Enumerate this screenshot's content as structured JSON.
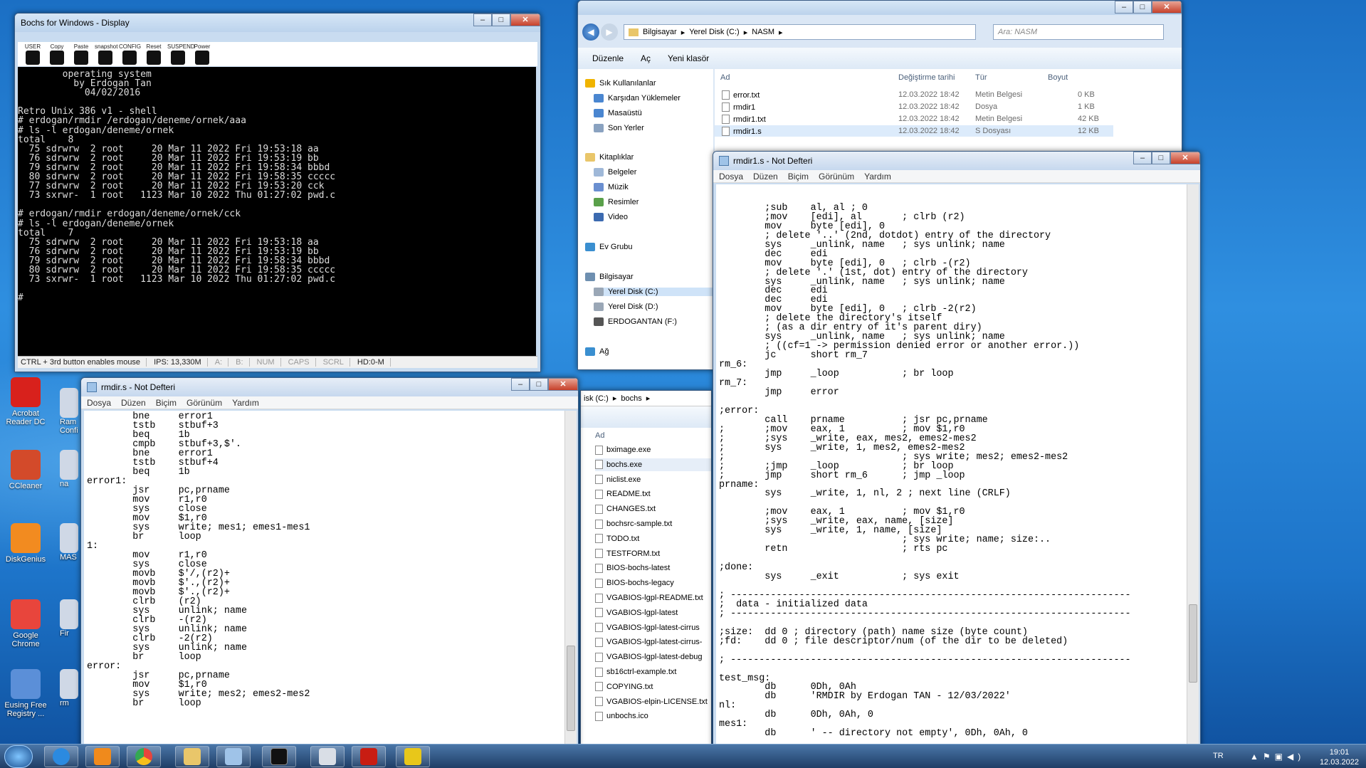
{
  "desktop": {
    "icons": [
      {
        "label": "Acrobat Reader DC",
        "color": "#d8211c"
      },
      {
        "label": "CCleaner",
        "color": "#d34a2a"
      },
      {
        "label": "DiskGenius",
        "color": "#f28b20"
      },
      {
        "label": "Google Chrome",
        "color": "#e8453c"
      },
      {
        "label": "Eusing Free Registry ...",
        "color": "#5b8fd8"
      }
    ],
    "partial_icons": [
      "Ram Confi",
      "na",
      "MAS",
      "Fir",
      "rm"
    ]
  },
  "bochs": {
    "title": "Bochs for Windows - Display",
    "toolbar": [
      "USER",
      "Copy",
      "Paste",
      "snapshot",
      "CONFIG",
      "Reset",
      "SUSPEND",
      "Power"
    ],
    "terminal": [
      "        operating system",
      "          by Erdogan Tan",
      "            04/02/2016",
      "",
      "Retro Unix 386 v1 - shell",
      "# erdogan/rmdir /erdogan/deneme/ornek/aaa",
      "# ls -l erdogan/deneme/ornek",
      "total    8",
      "  75 sdrwrw  2 root     20 Mar 11 2022 Fri 19:53:18 aa",
      "  76 sdrwrw  2 root     20 Mar 11 2022 Fri 19:53:19 bb",
      "  79 sdrwrw  2 root     20 Mar 11 2022 Fri 19:58:34 bbbd",
      "  80 sdrwrw  2 root     20 Mar 11 2022 Fri 19:58:35 ccccc",
      "  77 sdrwrw  2 root     20 Mar 11 2022 Fri 19:53:20 cck",
      "  73 sxrwr-  1 root   1123 Mar 10 2022 Thu 01:27:02 pwd.c",
      "",
      "# erdogan/rmdir erdogan/deneme/ornek/cck",
      "# ls -l erdogan/deneme/ornek",
      "total    7",
      "  75 sdrwrw  2 root     20 Mar 11 2022 Fri 19:53:18 aa",
      "  76 sdrwrw  2 root     20 Mar 11 2022 Fri 19:53:19 bb",
      "  79 sdrwrw  2 root     20 Mar 11 2022 Fri 19:58:34 bbbd",
      "  80 sdrwrw  2 root     20 Mar 11 2022 Fri 19:58:35 ccccc",
      "  73 sxrwr-  1 root   1123 Mar 10 2022 Thu 01:27:02 pwd.c",
      "",
      "#"
    ],
    "status": [
      "CTRL + 3rd button enables mouse",
      "IPS: 13,330M",
      "A:",
      "B:",
      "NUM",
      "CAPS",
      "SCRL",
      "HD:0-M"
    ]
  },
  "explorer": {
    "breadcrumb": [
      "Bilgisayar",
      "Yerel Disk (C:)",
      "NASM"
    ],
    "search_placeholder": "Ara: NASM",
    "toolbar": [
      "Düzenle",
      "Aç",
      "Yeni klasör"
    ],
    "columns": [
      "Ad",
      "Değiştirme tarihi",
      "Tür",
      "Boyut"
    ],
    "files": [
      {
        "name": "error.txt",
        "date": "12.03.2022 18:42",
        "type": "Metin Belgesi",
        "size": "0 KB"
      },
      {
        "name": "rmdir1",
        "date": "12.03.2022 18:42",
        "type": "Dosya",
        "size": "1 KB"
      },
      {
        "name": "rmdir1.txt",
        "date": "12.03.2022 18:42",
        "type": "Metin Belgesi",
        "size": "42 KB"
      },
      {
        "name": "rmdir1.s",
        "date": "12.03.2022 18:42",
        "type": "S Dosyası",
        "size": "12 KB"
      }
    ],
    "nav": [
      "Sık Kullanılanlar",
      "Karşıdan Yüklemeler",
      "Masaüstü",
      "Son Yerler",
      "Kitaplıklar",
      "Belgeler",
      "Müzik",
      "Resimler",
      "Video",
      "Ev Grubu",
      "Bilgisayar",
      "Yerel Disk (C:)",
      "Yerel Disk (D:)",
      "ERDOGANTAN (F:)",
      "Ağ"
    ]
  },
  "explorer2": {
    "breadcrumb": [
      "isk (C:)",
      "bochs"
    ],
    "column": "Ad",
    "files": [
      "bximage.exe",
      "bochs.exe",
      "niclist.exe",
      "README.txt",
      "CHANGES.txt",
      "bochsrc-sample.txt",
      "TODO.txt",
      "TESTFORM.txt",
      "BIOS-bochs-latest",
      "BIOS-bochs-legacy",
      "VGABIOS-lgpl-README.txt",
      "VGABIOS-lgpl-latest",
      "VGABIOS-lgpl-latest-cirrus",
      "VGABIOS-lgpl-latest-cirrus-",
      "VGABIOS-lgpl-latest-debug",
      "sb16ctrl-example.txt",
      "COPYING.txt",
      "VGABIOS-elpin-LICENSE.txt",
      "unbochs.ico"
    ]
  },
  "notepad_left": {
    "title": "rmdir.s - Not Defteri",
    "menu": [
      "Dosya",
      "Düzen",
      "Biçim",
      "Görünüm",
      "Yardım"
    ],
    "code": [
      "\tbne\terror1",
      "\ttstb\tstbuf+3",
      "\tbeq\t1b",
      "\tcmpb\tstbuf+3,$'.",
      "\tbne\terror1",
      "\ttstb\tstbuf+4",
      "\tbeq\t1b",
      "error1:",
      "\tjsr\tpc,prname",
      "\tmov\tr1,r0",
      "\tsys\tclose",
      "\tmov\t$1,r0",
      "\tsys\twrite; mes1; emes1-mes1",
      "\tbr\tloop",
      "1:",
      "\tmov\tr1,r0",
      "\tsys\tclose",
      "\tmovb\t$'/,(r2)+",
      "\tmovb\t$'.,(r2)+",
      "\tmovb\t$'.,(r2)+",
      "\tclrb\t(r2)",
      "\tsys\tunlink; name",
      "\tclrb\t-(r2)",
      "\tsys\tunlink; name",
      "\tclrb\t-2(r2)",
      "\tsys\tunlink; name",
      "\tbr\tloop",
      "error:",
      "\tjsr\tpc,prname",
      "\tmov\t$1,r0",
      "\tsys\twrite; mes2; emes2-mes2",
      "\tbr\tloop"
    ]
  },
  "notepad_right": {
    "title": "rmdir1.s - Not Defteri",
    "menu": [
      "Dosya",
      "Düzen",
      "Biçim",
      "Görünüm",
      "Yardım"
    ],
    "code": [
      "\t;sub\tal, al ; 0",
      "\t;mov\t[edi], al\t; clrb (r2)",
      "\tmov\tbyte [edi], 0",
      "\t; delete '..' (2nd, dotdot) entry of the directory",
      "\tsys\t_unlink, name\t; sys unlink; name",
      "\tdec\tedi",
      "\tmov\tbyte [edi], 0\t; clrb -(r2)",
      "\t; delete '.' (1st, dot) entry of the directory",
      "\tsys\t_unlink, name\t; sys unlink; name",
      "\tdec\tedi",
      "\tdec\tedi",
      "\tmov\tbyte [edi], 0\t; clrb -2(r2)",
      "\t; delete the directory's itself",
      "\t; (as a dir entry of it's parent diry)",
      "\tsys\t_unlink, name\t; sys unlink; name",
      "\t; ((cf=1 -> permission denied error or another error.))",
      "\tjc\tshort rm_7",
      "rm_6:",
      "\tjmp\t_loop\t\t; br loop",
      "rm_7:",
      "\tjmp\terror",
      "",
      ";error:",
      "\tcall\tprname\t\t; jsr pc,prname",
      ";\t;mov\teax, 1\t\t; mov $1,r0",
      ";\t;sys\t_write, eax, mes2, emes2-mes2",
      ";\tsys\t_write, 1, mes2, emes2-mes2",
      ";\t\t\t\t; sys write; mes2; emes2-mes2",
      ";\t;jmp\t_loop\t\t; br loop",
      ";\tjmp\tshort rm_6\t; jmp _loop",
      "prname:",
      "\tsys\t_write, 1, nl, 2 ; next line (CRLF)",
      "",
      "\t;mov\teax, 1\t\t; mov $1,r0",
      "\t;sys\t_write, eax, name, [size]",
      "\tsys\t_write, 1, name, [size]",
      "\t\t\t\t; sys write; name; size:..",
      "\tretn\t\t\t; rts pc",
      "",
      ";done:",
      "\tsys\t_exit\t\t; sys exit",
      "",
      "; ----------------------------------------------------------------------",
      ";  data - initialized data",
      "; ----------------------------------------------------------------------",
      "",
      ";size:\tdd 0 ; directory (path) name size (byte count)",
      ";fd:\tdd 0 ; file descriptor/num (of the dir to be deleted)",
      "",
      "; ----------------------------------------------------------------------",
      "",
      "test_msg:",
      "\tdb\t0Dh, 0Ah",
      "\tdb\t'RMDIR by Erdogan TAN - 12/03/2022'",
      "nl:",
      "\tdb\t0Dh, 0Ah, 0",
      "mes1:",
      "\tdb\t' -- directory not empty', 0Dh, 0Ah, 0"
    ]
  },
  "taskbar": {
    "lang": "TR",
    "time": "19:01",
    "date": "12.03.2022"
  }
}
